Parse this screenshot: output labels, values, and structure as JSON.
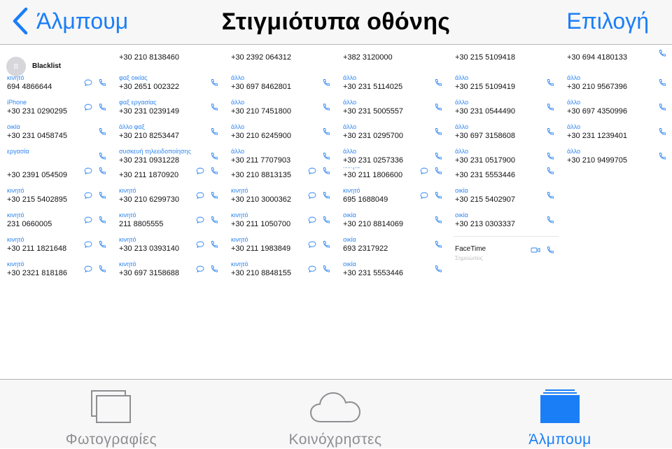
{
  "colors": {
    "accent": "#1a7ef7",
    "inactive": "#8e8e93",
    "label_blue": "#2f86f0"
  },
  "navbar": {
    "back_label": "Άλμπουμ",
    "title": "Στιγμιότυπα οθόνης",
    "select_label": "Επιλογή",
    "back_icon": "chevron-left-icon"
  },
  "screenshots": {
    "columns": [
      {
        "top_rows": [
          {
            "type": "blacklist",
            "initial": "B",
            "name": "Blacklist"
          },
          {
            "label": "κινητό",
            "number": "694 4866644",
            "icons": [
              "msg",
              "phone"
            ]
          },
          {
            "label": "iPhone",
            "number": "+30 231 0290295",
            "icons": [
              "msg",
              "phone"
            ]
          },
          {
            "label": "οικία",
            "number": "+30 231 0458745",
            "icons": [
              "phone"
            ]
          },
          {
            "label": "εργασία",
            "number": "",
            "icons": [
              "phone"
            ]
          }
        ],
        "bottom_rows": [
          {
            "label": "",
            "number": "+30 2391 054509",
            "icons": [
              "msg",
              "phone"
            ]
          },
          {
            "label": "κινητό",
            "number": "+30 215 5402895",
            "icons": [
              "msg",
              "phone"
            ]
          },
          {
            "label": "κινητό",
            "number": "231 0660005",
            "icons": [
              "msg",
              "phone"
            ]
          },
          {
            "label": "κινητό",
            "number": "+30 211 1821648",
            "icons": [
              "msg",
              "phone"
            ]
          },
          {
            "label": "κινητό",
            "number": "+30 2321 818186",
            "icons": [
              "msg",
              "phone"
            ]
          }
        ]
      },
      {
        "top_rows": [
          {
            "label": "",
            "number": "+30 210 8138460",
            "icons": []
          },
          {
            "label": "φαξ οικίας",
            "number": "+30 2651 002322",
            "icons": [
              "phone"
            ]
          },
          {
            "label": "φαξ εργασίας",
            "number": "+30 231 0239149",
            "icons": [
              "phone"
            ]
          },
          {
            "label": "άλλο φαξ",
            "number": "+30 210 8253447",
            "icons": [
              "phone"
            ]
          },
          {
            "label": "συσκευή τηλεειδοποίησης",
            "number": "+30 231 0931228",
            "icons": [
              "phone"
            ]
          }
        ],
        "bottom_rows": [
          {
            "label": "",
            "number": "+30 211 1870920",
            "icons": [
              "msg",
              "phone"
            ]
          },
          {
            "label": "κινητό",
            "number": "+30 210 6299730",
            "icons": [
              "msg",
              "phone"
            ]
          },
          {
            "label": "κινητό",
            "number": "211 8805555",
            "icons": [
              "msg",
              "phone"
            ]
          },
          {
            "label": "κινητό",
            "number": "+30 213 0393140",
            "icons": [
              "msg",
              "phone"
            ]
          },
          {
            "label": "κινητό",
            "number": "+30 697 3158688",
            "icons": [
              "msg",
              "phone"
            ]
          }
        ]
      },
      {
        "top_rows": [
          {
            "label": "",
            "number": "+30 2392 064312",
            "icons": []
          },
          {
            "label": "άλλο",
            "number": "+30 697 8462801",
            "icons": [
              "phone"
            ]
          },
          {
            "label": "άλλο",
            "number": "+30 210 7451800",
            "icons": [
              "phone"
            ]
          },
          {
            "label": "άλλο",
            "number": "+30 210 6245900",
            "icons": [
              "phone"
            ]
          },
          {
            "label": "άλλο",
            "number": "+30 211 7707903",
            "icons": [
              "phone"
            ]
          }
        ],
        "bottom_rows": [
          {
            "label": "",
            "number": "+30 210 8813135",
            "icons": [
              "msg",
              "phone"
            ]
          },
          {
            "label": "κινητό",
            "number": "+30 210 3000362",
            "icons": [
              "msg",
              "phone"
            ]
          },
          {
            "label": "κινητό",
            "number": "+30 211 1050700",
            "icons": [
              "msg",
              "phone"
            ]
          },
          {
            "label": "κινητό",
            "number": "+30 211 1983849",
            "icons": [
              "msg",
              "phone"
            ]
          },
          {
            "label": "κινητό",
            "number": "+30 210 8848155",
            "icons": [
              "msg",
              "phone"
            ]
          }
        ]
      },
      {
        "top_rows": [
          {
            "label": "",
            "number": "+382 3120000",
            "icons": []
          },
          {
            "label": "άλλο",
            "number": "+30 231 5114025",
            "icons": [
              "phone"
            ]
          },
          {
            "label": "άλλο",
            "number": "+30 231 5005557",
            "icons": [
              "phone"
            ]
          },
          {
            "label": "άλλο",
            "number": "+30 231 0295700",
            "icons": [
              "phone"
            ]
          },
          {
            "label": "άλλο",
            "number": "+30 231 0257336",
            "icons": [
              "phone"
            ]
          }
        ],
        "bottom_rows": [
          {
            "label": "κινητό",
            "number": "+30 211 1806600",
            "icons": [
              "msg",
              "phone"
            ]
          },
          {
            "label": "κινητό",
            "number": "695 1688049",
            "icons": [
              "msg",
              "phone"
            ]
          },
          {
            "label": "οικία",
            "number": "+30 210 8814069",
            "icons": [
              "phone"
            ]
          },
          {
            "label": "οικία",
            "number": "693 2317922",
            "icons": [
              "phone"
            ]
          },
          {
            "label": "οικία",
            "number": "+30 231 5553446",
            "icons": [
              "phone"
            ]
          }
        ]
      },
      {
        "top_rows": [
          {
            "label": "",
            "number": "+30 215 5109418",
            "icons": []
          },
          {
            "label": "άλλο",
            "number": "+30 215 5109419",
            "icons": [
              "phone"
            ]
          },
          {
            "label": "άλλο",
            "number": "+30 231 0544490",
            "icons": [
              "phone"
            ]
          },
          {
            "label": "άλλο",
            "number": "+30 697 3158608",
            "icons": [
              "phone"
            ]
          },
          {
            "label": "άλλο",
            "number": "+30 231 0517900",
            "icons": [
              "phone"
            ]
          }
        ],
        "bottom_rows": [
          {
            "label": "",
            "number": "+30 231 5553446",
            "icons": [
              "phone"
            ]
          },
          {
            "label": "οικία",
            "number": "+30 215 5402907",
            "icons": [
              "phone"
            ]
          },
          {
            "label": "οικία",
            "number": "+30 213 0303337",
            "icons": [
              "phone"
            ]
          },
          {
            "type": "facetime",
            "name": "FaceTime",
            "icons": [
              "video",
              "phone"
            ]
          },
          {
            "type": "notes",
            "name": "Σημειώσεις"
          }
        ]
      },
      {
        "top_rows": [
          {
            "label": "",
            "number": "+30 694 4180133",
            "icons": [
              "phone"
            ]
          },
          {
            "label": "άλλο",
            "number": "+30 210 9567396",
            "icons": [
              "phone"
            ]
          },
          {
            "label": "άλλο",
            "number": "+30 697 4350996",
            "icons": [
              "phone"
            ]
          },
          {
            "label": "άλλο",
            "number": "+30 231 1239401",
            "icons": [
              "phone"
            ]
          },
          {
            "label": "άλλο",
            "number": "+30 210 9499705",
            "icons": [
              "phone"
            ]
          }
        ],
        "bottom_rows": []
      }
    ]
  },
  "tabbar": {
    "tabs": [
      {
        "label": "Φωτογραφίες",
        "icon": "photos-icon",
        "active": false
      },
      {
        "label": "Κοινόχρηστες",
        "icon": "cloud-icon",
        "active": false
      },
      {
        "label": "Άλμπουμ",
        "icon": "albums-icon",
        "active": true
      }
    ]
  }
}
